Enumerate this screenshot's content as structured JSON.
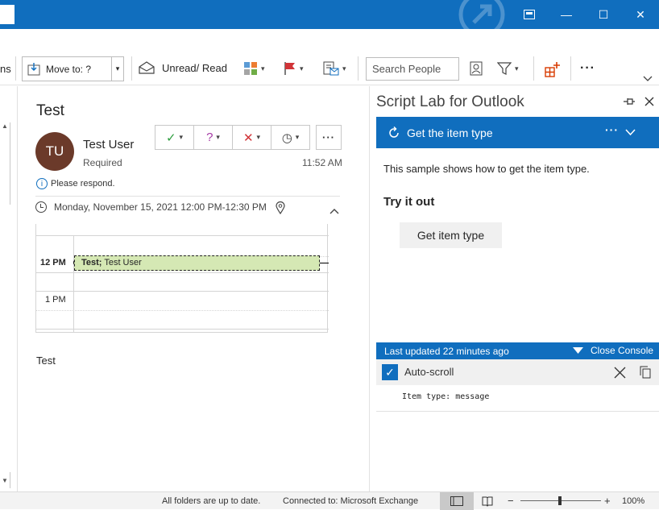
{
  "window": {
    "minimize": "—",
    "maximize": "☐",
    "close": "✕"
  },
  "ribbon": {
    "partial_label": "ns",
    "move_to": "Move to: ?",
    "unread_read": "Unread/ Read",
    "search_people_placeholder": "Search People",
    "more": "···"
  },
  "message": {
    "subject": "Test",
    "avatar_initials": "TU",
    "sender_name": "Test User",
    "sender_role": "Required",
    "time": "11:52 AM",
    "notice": "Please respond.",
    "when": "Monday, November 15, 2021 12:00 PM-12:30 PM",
    "calendar": {
      "hour_12": "12 PM",
      "hour_1": "1 PM",
      "appointment_bold": "Test;",
      "appointment_rest": " Test User"
    },
    "body": "Test"
  },
  "addin": {
    "title": "Script Lab for Outlook",
    "sample_title": "Get the item type",
    "sample_menu": "···",
    "description": "This sample shows how to get the item type.",
    "try_heading": "Try it out",
    "button_label": "Get item type",
    "console": {
      "last_updated": "Last updated 22 minutes ago",
      "close_label": "Close Console",
      "autoscroll_label": "Auto-scroll",
      "log_line": "Item type: message"
    }
  },
  "status": {
    "sync": "All folders are up to date.",
    "connection": "Connected to: Microsoft Exchange",
    "zoom_minus": "−",
    "zoom_plus": "+",
    "zoom": "100%"
  },
  "colors": {
    "accent": "#106ebe",
    "avatar": "#6b3a2a",
    "accept": "#2e9e3e",
    "tentative": "#a53aa5",
    "decline": "#d13438",
    "appointment": "#d5e8b4"
  }
}
